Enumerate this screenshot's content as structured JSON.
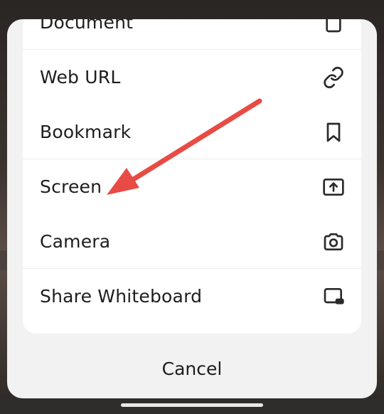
{
  "menu": {
    "items": [
      {
        "label": "Document",
        "icon": "document-icon"
      },
      {
        "label": "Web URL",
        "icon": "link-icon"
      },
      {
        "label": "Bookmark",
        "icon": "bookmark-icon"
      },
      {
        "label": "Screen",
        "icon": "screen-share-icon"
      },
      {
        "label": "Camera",
        "icon": "camera-icon"
      },
      {
        "label": "Share Whiteboard",
        "icon": "whiteboard-icon"
      }
    ],
    "cancel_label": "Cancel"
  },
  "annotation": {
    "arrow_color": "#e84b43",
    "target": "Screen"
  }
}
